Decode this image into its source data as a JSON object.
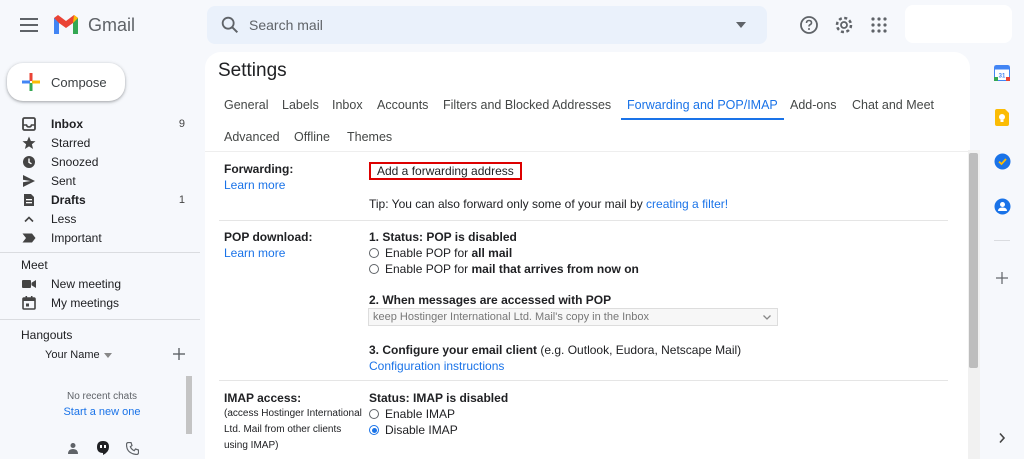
{
  "header": {
    "app_name": "Gmail",
    "search_placeholder": "Search mail"
  },
  "sidebar": {
    "compose_label": "Compose",
    "items": [
      {
        "label": "Inbox",
        "count": "9",
        "icon": "inbox-icon",
        "bold": true
      },
      {
        "label": "Starred",
        "count": "",
        "icon": "star-icon"
      },
      {
        "label": "Snoozed",
        "count": "",
        "icon": "clock-icon"
      },
      {
        "label": "Sent",
        "count": "",
        "icon": "send-icon"
      },
      {
        "label": "Drafts",
        "count": "1",
        "icon": "draft-icon",
        "bold": true
      },
      {
        "label": "Less",
        "count": "",
        "icon": "chevron-up-icon"
      },
      {
        "label": "Important",
        "count": "",
        "icon": "important-icon"
      }
    ],
    "meet": {
      "title": "Meet",
      "items": [
        {
          "label": "New meeting",
          "icon": "video-icon"
        },
        {
          "label": "My meetings",
          "icon": "calendar-icon"
        }
      ]
    },
    "hangouts": {
      "title": "Hangouts",
      "user_name": "Your Name",
      "no_chats": "No recent chats",
      "start_chat": "Start a new one"
    }
  },
  "settings": {
    "title": "Settings",
    "tabs": [
      "General",
      "Labels",
      "Inbox",
      "Accounts",
      "Filters and Blocked Addresses",
      "Forwarding and POP/IMAP",
      "Add-ons",
      "Chat and Meet"
    ],
    "tabs_row2": [
      "Advanced",
      "Offline",
      "Themes"
    ],
    "active_tab": "Forwarding and POP/IMAP",
    "forwarding": {
      "label": "Forwarding:",
      "learn_more": "Learn more",
      "button": "Add a forwarding address",
      "tip_prefix": "Tip: You can also forward only some of your mail by ",
      "tip_link": "creating a filter!"
    },
    "pop": {
      "label": "POP download:",
      "learn_more": "Learn more",
      "status": "1. Status: POP is disabled",
      "option1_prefix": "Enable POP for ",
      "option1_bold": "all mail",
      "option2_prefix": "Enable POP for ",
      "option2_bold": "mail that arrives from now on",
      "access_title": "2. When messages are accessed with POP",
      "access_select": "keep Hostinger International Ltd. Mail's copy in the Inbox",
      "configure_title": "3. Configure your email client",
      "configure_suffix": " (e.g. Outlook, Eudora, Netscape Mail)",
      "configure_link": "Configuration instructions"
    },
    "imap": {
      "label": "IMAP access:",
      "note": "(access Hostinger International Ltd. Mail from other clients using IMAP)",
      "status": "Status: IMAP is disabled",
      "option_enable": "Enable IMAP",
      "option_disable": "Disable IMAP",
      "selected": "Disable IMAP"
    }
  },
  "colors": {
    "accent": "#1a73e8",
    "highlight_border": "#dd0000"
  }
}
